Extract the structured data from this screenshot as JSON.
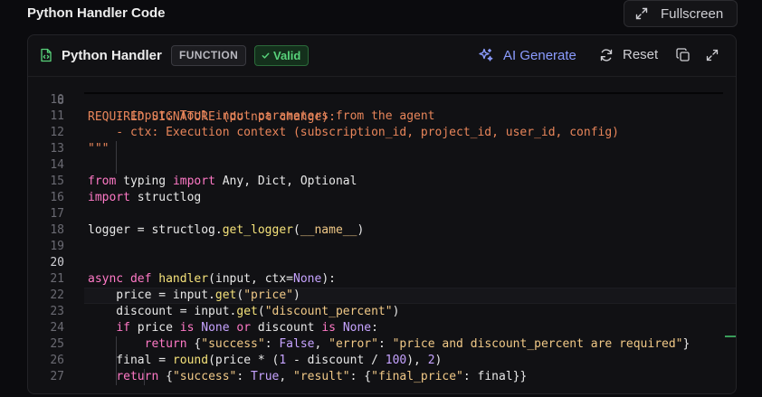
{
  "header": {
    "title": "Python Handler Code",
    "fullscreen_label": "Fullscreen"
  },
  "editor": {
    "title": "Python Handler",
    "type_badge": "FUNCTION",
    "valid_badge": "Valid",
    "ai_generate_label": "AI Generate",
    "reset_label": "Reset",
    "active_line": 20,
    "sticky": {
      "num": "8",
      "text": "REQUIRED SIGNATURE (do not change):"
    },
    "lines": [
      {
        "num": "10",
        "text": ""
      },
      {
        "num": "11",
        "text": "    - input: Tool input parameters from the agent"
      },
      {
        "num": "12",
        "text": "    - ctx: Execution context (subscription_id, project_id, user_id, config)"
      },
      {
        "num": "13",
        "text": "\"\"\""
      },
      {
        "num": "14",
        "text": ""
      },
      {
        "num": "15",
        "text": "from typing import Any, Dict, Optional"
      },
      {
        "num": "16",
        "text": "import structlog"
      },
      {
        "num": "17",
        "text": ""
      },
      {
        "num": "18",
        "text": "logger = structlog.get_logger(__name__)"
      },
      {
        "num": "19",
        "text": ""
      },
      {
        "num": "20",
        "text": ""
      },
      {
        "num": "21",
        "text": "async def handler(input, ctx=None):"
      },
      {
        "num": "22",
        "text": "    price = input.get(\"price\")"
      },
      {
        "num": "23",
        "text": "    discount = input.get(\"discount_percent\")"
      },
      {
        "num": "24",
        "text": "    if price is None or discount is None:"
      },
      {
        "num": "25",
        "text": "        return {\"success\": False, \"error\": \"price and discount_percent are required\"}"
      },
      {
        "num": "26",
        "text": "    final = round(price * (1 - discount / 100), 2)"
      },
      {
        "num": "27",
        "text": "    return {\"success\": True, \"result\": {\"final_price\": final}}"
      }
    ]
  },
  "colors": {
    "accent": "#8b9cff",
    "valid": "#58d27a",
    "keyword": "#ff79c6",
    "string": "#f1c987",
    "comment": "#e8855a"
  },
  "icons": {
    "fullscreen": "expand-arrows-icon",
    "file": "code-file-icon",
    "valid": "check-icon",
    "ai": "sparkles-icon",
    "reset": "refresh-icon",
    "copy": "copy-icon",
    "expand": "expand-icon"
  }
}
